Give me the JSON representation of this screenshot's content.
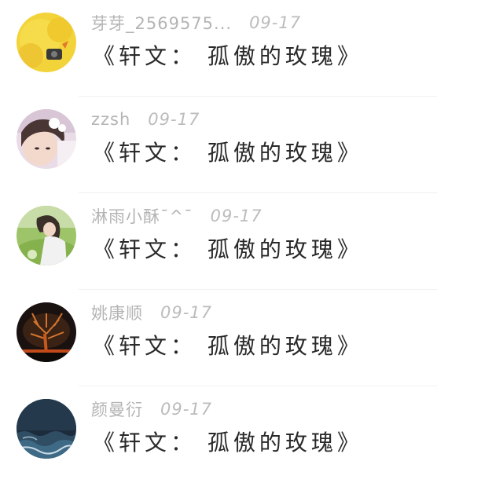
{
  "comments": [
    {
      "username": "芽芽_2569575...",
      "date": "09-17",
      "text": "《轩文： 孤傲的玫瑰》",
      "avatar": "yellow-plush-avatar"
    },
    {
      "username": "zzsh",
      "date": "09-17",
      "text": "《轩文： 孤傲的玫瑰》",
      "avatar": "girl-portrait-avatar"
    },
    {
      "username": "淋雨小酥¯^¯",
      "date": "09-17",
      "text": "《轩文： 孤傲的玫瑰》",
      "avatar": "girl-on-grass-avatar"
    },
    {
      "username": "姚康顺",
      "date": "09-17",
      "text": "《轩文： 孤傲的玫瑰》",
      "avatar": "glowing-tree-avatar"
    },
    {
      "username": "颜曼衍",
      "date": "09-17",
      "text": "《轩文： 孤傲的玫瑰》",
      "avatar": "ocean-storm-avatar"
    }
  ]
}
